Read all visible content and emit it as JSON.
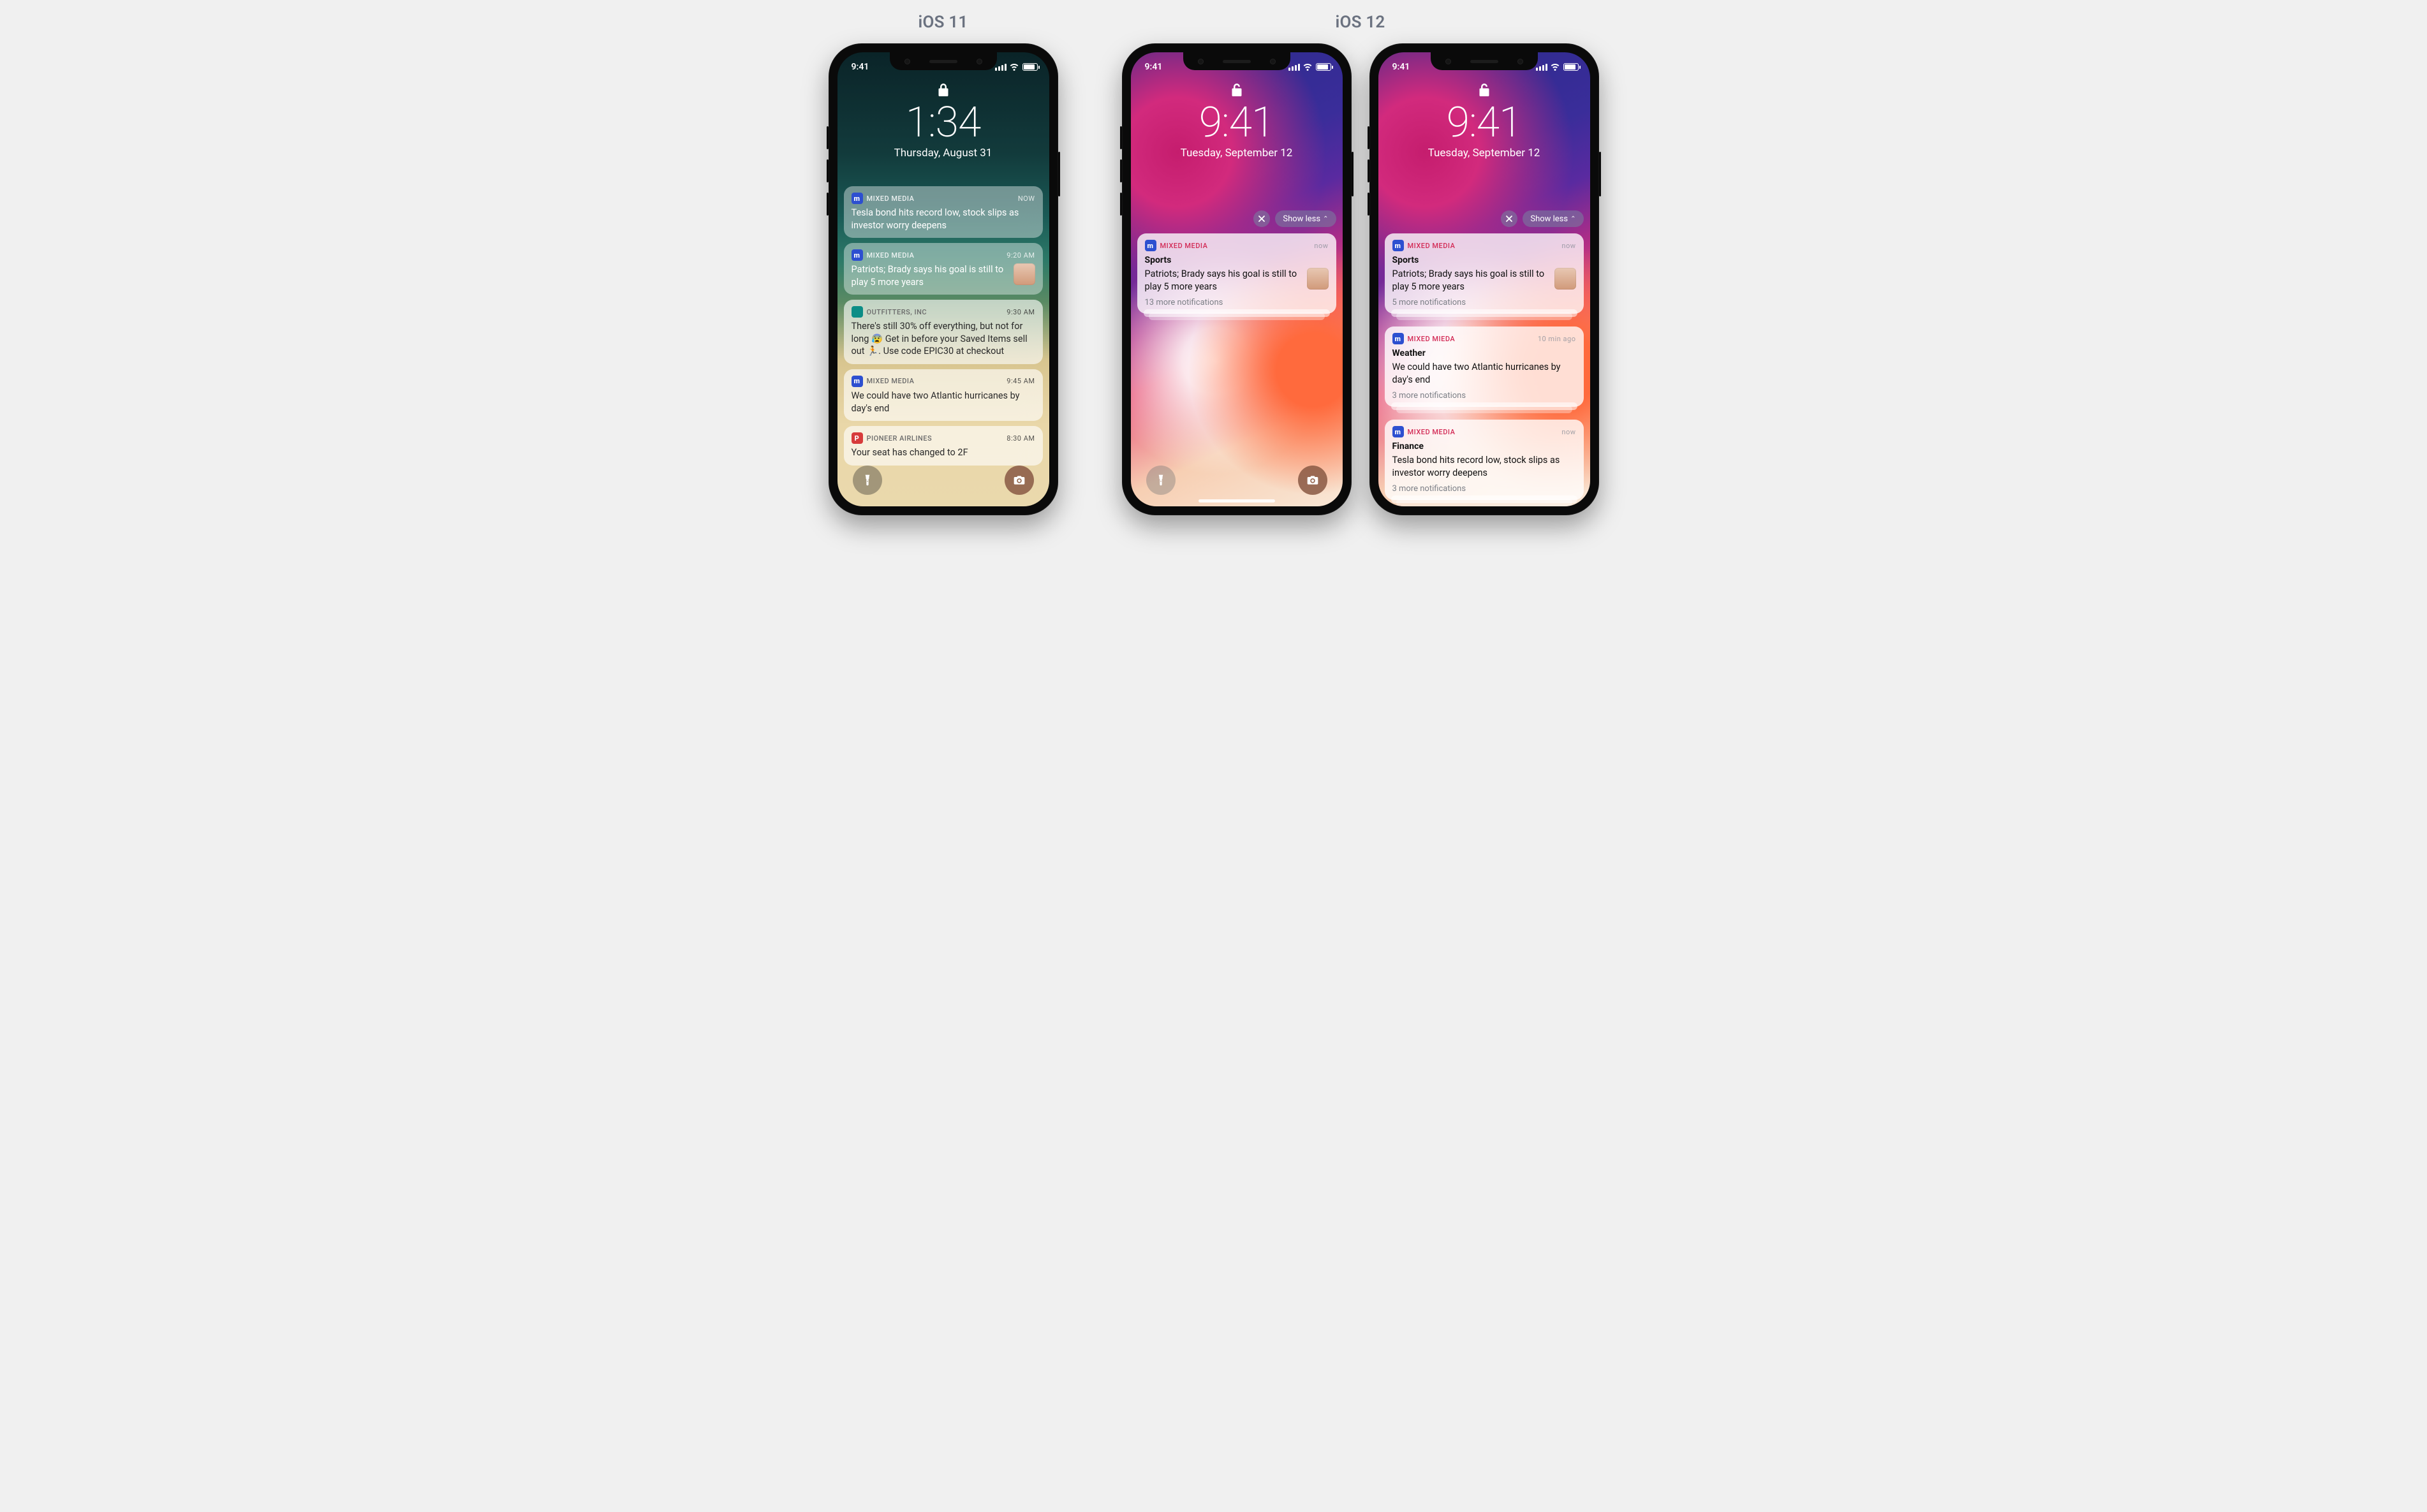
{
  "labels": {
    "ios11": "iOS 11",
    "ios12": "iOS 12"
  },
  "ios11": {
    "statusTime": "9:41",
    "locked": true,
    "clock": "1:34",
    "date": "Thursday, August 31",
    "notifications": [
      {
        "app": "MIXED MEDIA",
        "iconKey": "m",
        "timestamp": "NOW",
        "body": "Tesla bond hits record low, stock slips as investor worry deepens",
        "hasThumb": false,
        "tone": "dark"
      },
      {
        "app": "MIXED MEDIA",
        "iconKey": "m",
        "timestamp": "9:20 AM",
        "body": "Patriots; Brady says his goal is still to play 5 more years",
        "hasThumb": true,
        "tone": "dark"
      },
      {
        "app": "OUTFITTERS, INC",
        "iconKey": "o",
        "timestamp": "9:30 AM",
        "body": "There's still 30% off everything, but not for long 😰 Get in before your Saved Items sell out 🏃. Use code EPIC30 at checkout",
        "hasThumb": false,
        "tone": "light"
      },
      {
        "app": "MIXED MEDIA",
        "iconKey": "m",
        "timestamp": "9:45 AM",
        "body": "We could have two Atlantic hurricanes by day's end",
        "hasThumb": false,
        "tone": "light"
      },
      {
        "app": "PIONEER AIRLINES",
        "iconKey": "p",
        "timestamp": "8:30 AM",
        "body": "Your seat has changed to 2F",
        "hasThumb": false,
        "tone": "light"
      }
    ]
  },
  "ios12": {
    "statusTime": "9:41",
    "locked": false,
    "clock": "9:41",
    "date": "Tuesday, September 12",
    "groupControls": {
      "showLess": "Show less"
    },
    "phoneA": {
      "groups": [
        {
          "app": "MIXED MEDIA",
          "iconKey": "m",
          "timestamp": "now",
          "title": "Sports",
          "body": "Patriots; Brady says his goal is still to play 5 more years",
          "hasThumb": true,
          "more": "13 more notifications"
        }
      ]
    },
    "phoneB": {
      "groups": [
        {
          "app": "MIXED MEDIA",
          "iconKey": "m",
          "timestamp": "now",
          "title": "Sports",
          "body": "Patriots; Brady says his goal is still to play 5 more years",
          "hasThumb": true,
          "more": "5 more notifications"
        },
        {
          "app": "MIXED MIEDA",
          "iconKey": "m",
          "timestamp": "10 min ago",
          "title": "Weather",
          "body": "We could have two Atlantic hurricanes by day's end",
          "hasThumb": false,
          "more": "3 more notifications"
        },
        {
          "app": "MIXED MEDIA",
          "iconKey": "m",
          "timestamp": "now",
          "title": "Finance",
          "body": "Tesla bond hits record low, stock slips as investor worry deepens",
          "hasThumb": false,
          "more": "3 more notifications"
        }
      ]
    }
  },
  "icons": {
    "m": {
      "glyph": "m",
      "class": "app-blue"
    },
    "o": {
      "glyph": "",
      "class": "app-teal"
    },
    "p": {
      "glyph": "P",
      "class": "app-red"
    }
  }
}
